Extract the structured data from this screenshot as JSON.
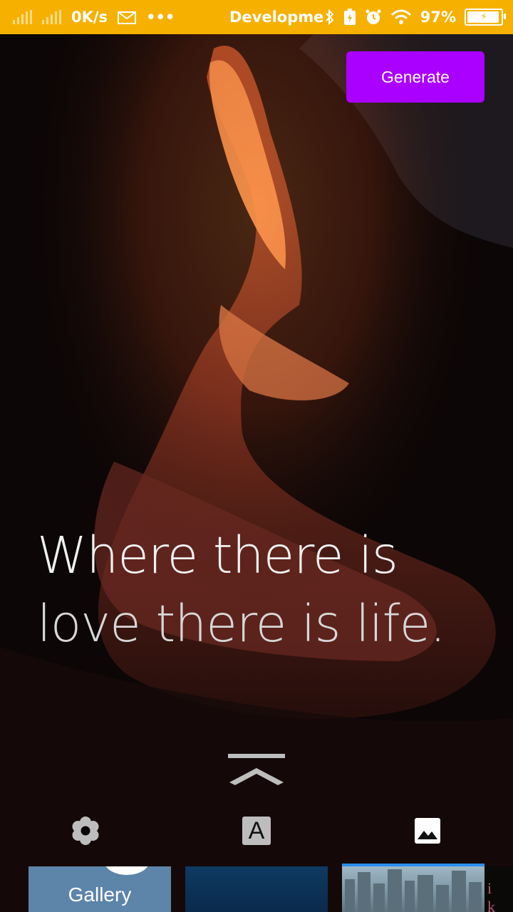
{
  "status_bar": {
    "network_speed": "0K/s",
    "more": "•••",
    "notification_title": "Developme",
    "battery_percent": "97%",
    "icons": [
      "signal-icon",
      "signal-icon",
      "mail-icon",
      "bluetooth-icon",
      "battery-saver-icon",
      "alarm-icon",
      "wifi-icon",
      "battery-icon"
    ]
  },
  "header": {
    "generate_label": "Generate",
    "generate_color": "#aa00ff"
  },
  "quote": {
    "line1": "Where there is",
    "line2": "love there is life."
  },
  "toolbar": {
    "items": [
      "effects-icon",
      "text-icon",
      "image-icon"
    ],
    "text_icon_glyph": "A"
  },
  "thumbnails": {
    "gallery_label": "Gallery",
    "partial_text": "i k"
  },
  "colors": {
    "status_bar": "#f6b100",
    "accent": "#aa00ff",
    "selected_border": "#2a8ff0"
  }
}
